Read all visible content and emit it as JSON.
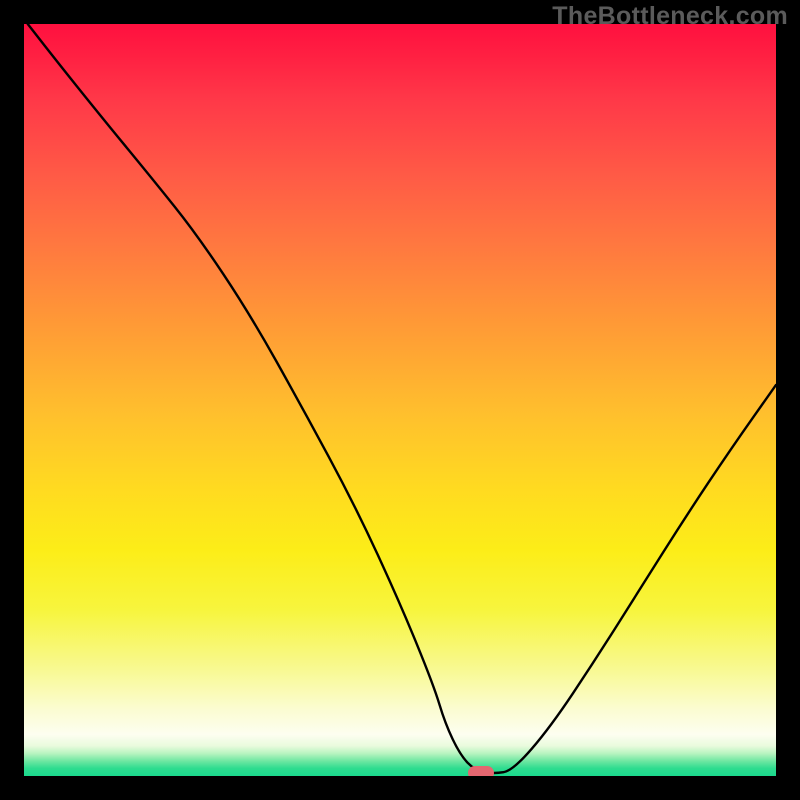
{
  "watermark": "TheBottleneck.com",
  "chart_data": {
    "type": "line",
    "title": "",
    "xlabel": "",
    "ylabel": "",
    "xlim": [
      0,
      100
    ],
    "ylim": [
      0,
      100
    ],
    "x": [
      0.5,
      4,
      10,
      17,
      23,
      30,
      37,
      44,
      50,
      54.5,
      56,
      58,
      60,
      62.5,
      65,
      70,
      76,
      82,
      88,
      94,
      100
    ],
    "values": [
      100,
      95.5,
      88,
      79.5,
      72,
      61.5,
      49,
      36,
      23,
      12,
      7,
      2.8,
      0.7,
      0.3,
      0.7,
      6.5,
      15.5,
      25,
      34.5,
      43.5,
      52
    ],
    "marker": {
      "x": 60.8,
      "y": 0.35
    },
    "colors": {
      "top": "#ff103f",
      "mid": "#ffd21f",
      "bottom": "#1bd98d",
      "line": "#000000",
      "pill": "#e46670",
      "frame": "#000000"
    }
  }
}
